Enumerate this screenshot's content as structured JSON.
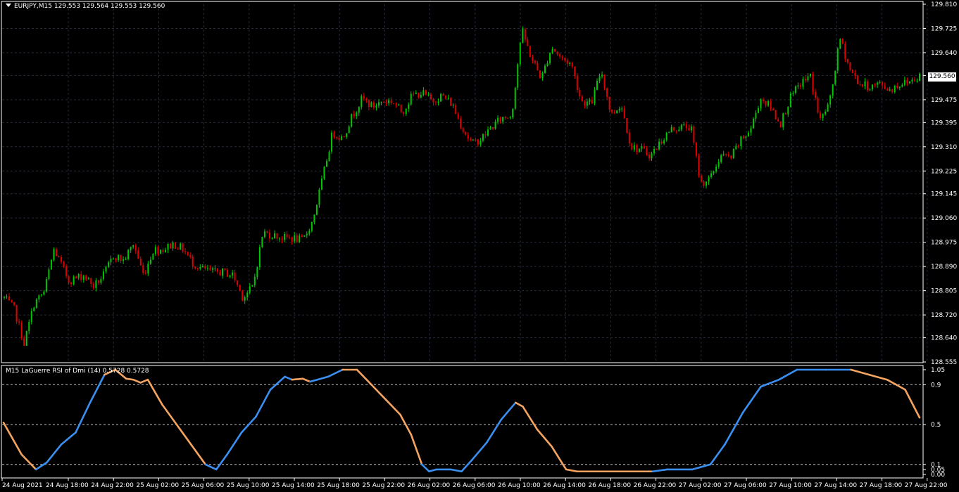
{
  "main_title": "EURJPY,M15  129.553 129.564 129.553 129.560",
  "indicator_title": "M15 LaGuerre RSI of Dmi (14) 0.5728 0.5728",
  "current_price": "129.560",
  "colors": {
    "background": "#000000",
    "grid": "#232b3d",
    "bull_candle": "#00c800",
    "bear_candle": "#e00000",
    "rsi_up": "#3b8ff0",
    "rsi_down": "#f4a460",
    "level_line": "#bfbfbf"
  },
  "chart_data": [
    {
      "type": "candlestick",
      "symbol": "EURJPY",
      "timeframe": "M15",
      "ylim": [
        128.555,
        129.81
      ],
      "y_ticks": [
        "129.810",
        "129.725",
        "129.640",
        "129.560",
        "129.475",
        "129.395",
        "129.310",
        "129.225",
        "129.145",
        "129.060",
        "128.975",
        "128.890",
        "128.805",
        "128.720",
        "128.640",
        "128.555"
      ],
      "x_ticks": [
        "24 Aug 2021",
        "24 Aug 18:00",
        "24 Aug 22:00",
        "25 Aug 02:00",
        "25 Aug 06:00",
        "25 Aug 10:00",
        "25 Aug 14:00",
        "25 Aug 18:00",
        "25 Aug 22:00",
        "26 Aug 02:00",
        "26 Aug 06:00",
        "26 Aug 10:00",
        "26 Aug 14:00",
        "26 Aug 18:00",
        "26 Aug 22:00",
        "27 Aug 02:00",
        "27 Aug 06:00",
        "27 Aug 10:00",
        "27 Aug 14:00",
        "27 Aug 18:00",
        "27 Aug 22:00"
      ],
      "close_path": [
        [
          0,
          128.78
        ],
        [
          4,
          128.74
        ],
        [
          8,
          128.62
        ],
        [
          12,
          128.76
        ],
        [
          16,
          128.8
        ],
        [
          20,
          128.95
        ],
        [
          26,
          128.84
        ],
        [
          32,
          128.86
        ],
        [
          36,
          128.82
        ],
        [
          40,
          128.86
        ],
        [
          44,
          128.93
        ],
        [
          48,
          128.91
        ],
        [
          52,
          128.97
        ],
        [
          56,
          128.86
        ],
        [
          60,
          128.95
        ],
        [
          64,
          128.95
        ],
        [
          68,
          128.97
        ],
        [
          72,
          128.95
        ],
        [
          76,
          128.9
        ],
        [
          80,
          128.88
        ],
        [
          84,
          128.87
        ],
        [
          88,
          128.87
        ],
        [
          92,
          128.86
        ],
        [
          96,
          128.78
        ],
        [
          100,
          128.82
        ],
        [
          104,
          129.01
        ],
        [
          108,
          129.0
        ],
        [
          112,
          128.99
        ],
        [
          116,
          128.99
        ],
        [
          120,
          128.98
        ],
        [
          124,
          129.05
        ],
        [
          128,
          129.2
        ],
        [
          132,
          129.36
        ],
        [
          136,
          129.34
        ],
        [
          140,
          129.42
        ],
        [
          144,
          129.48
        ],
        [
          148,
          129.45
        ],
        [
          152,
          129.47
        ],
        [
          156,
          129.47
        ],
        [
          160,
          129.43
        ],
        [
          164,
          129.49
        ],
        [
          168,
          129.5
        ],
        [
          172,
          129.47
        ],
        [
          176,
          129.49
        ],
        [
          180,
          129.46
        ],
        [
          184,
          129.38
        ],
        [
          188,
          129.32
        ],
        [
          192,
          129.34
        ],
        [
          196,
          129.38
        ],
        [
          200,
          129.41
        ],
        [
          204,
          129.42
        ],
        [
          208,
          129.72
        ],
        [
          212,
          129.62
        ],
        [
          216,
          129.55
        ],
        [
          220,
          129.66
        ],
        [
          224,
          129.62
        ],
        [
          228,
          129.6
        ],
        [
          232,
          129.47
        ],
        [
          236,
          129.46
        ],
        [
          240,
          129.58
        ],
        [
          244,
          129.42
        ],
        [
          248,
          129.46
        ],
        [
          252,
          129.31
        ],
        [
          256,
          129.3
        ],
        [
          260,
          129.28
        ],
        [
          264,
          129.33
        ],
        [
          268,
          129.37
        ],
        [
          272,
          129.38
        ],
        [
          276,
          129.38
        ],
        [
          280,
          129.18
        ],
        [
          284,
          129.2
        ],
        [
          288,
          129.28
        ],
        [
          292,
          129.27
        ],
        [
          296,
          129.33
        ],
        [
          300,
          129.37
        ],
        [
          304,
          129.48
        ],
        [
          308,
          129.45
        ],
        [
          312,
          129.39
        ],
        [
          316,
          129.48
        ],
        [
          320,
          129.53
        ],
        [
          324,
          129.56
        ],
        [
          328,
          129.4
        ],
        [
          332,
          129.47
        ],
        [
          336,
          129.69
        ],
        [
          340,
          129.58
        ],
        [
          344,
          129.53
        ],
        [
          348,
          129.52
        ],
        [
          352,
          129.53
        ],
        [
          356,
          129.51
        ],
        [
          360,
          129.53
        ],
        [
          364,
          129.54
        ],
        [
          368,
          129.56
        ]
      ]
    },
    {
      "type": "line",
      "ylim": [
        0.0,
        1.05
      ],
      "y_ticks": [
        "1.05",
        "0.9",
        "0.5",
        "0.1",
        "0.05",
        "0.00"
      ],
      "levels": [
        0.9,
        0.5,
        0.1
      ],
      "points": [
        [
          0,
          0.52,
          "d"
        ],
        [
          10,
          0.2,
          "d"
        ],
        [
          18,
          0.05,
          "d"
        ],
        [
          24,
          0.12,
          "u"
        ],
        [
          32,
          0.3,
          "u"
        ],
        [
          40,
          0.42,
          "u"
        ],
        [
          48,
          0.72,
          "u"
        ],
        [
          56,
          1.0,
          "u"
        ],
        [
          62,
          1.05,
          "d"
        ],
        [
          68,
          0.96,
          "d"
        ],
        [
          72,
          0.95,
          "d"
        ],
        [
          76,
          0.92,
          "d"
        ],
        [
          80,
          0.95,
          "d"
        ],
        [
          88,
          0.7,
          "d"
        ],
        [
          96,
          0.5,
          "d"
        ],
        [
          104,
          0.3,
          "d"
        ],
        [
          112,
          0.1,
          "d"
        ],
        [
          118,
          0.05,
          "u"
        ],
        [
          124,
          0.2,
          "u"
        ],
        [
          132,
          0.42,
          "u"
        ],
        [
          140,
          0.58,
          "u"
        ],
        [
          148,
          0.85,
          "u"
        ],
        [
          156,
          0.98,
          "u"
        ],
        [
          160,
          0.95,
          "u"
        ],
        [
          166,
          0.96,
          "d"
        ],
        [
          170,
          0.93,
          "d"
        ],
        [
          174,
          0.95,
          "u"
        ],
        [
          180,
          0.98,
          "u"
        ],
        [
          188,
          1.05,
          "u"
        ],
        [
          196,
          1.05,
          "d"
        ],
        [
          204,
          0.9,
          "d"
        ],
        [
          212,
          0.75,
          "d"
        ],
        [
          220,
          0.6,
          "d"
        ],
        [
          226,
          0.4,
          "d"
        ],
        [
          232,
          0.1,
          "d"
        ],
        [
          236,
          0.03,
          "u"
        ],
        [
          240,
          0.05,
          "u"
        ],
        [
          248,
          0.05,
          "u"
        ],
        [
          254,
          0.03,
          "u"
        ],
        [
          260,
          0.15,
          "u"
        ],
        [
          268,
          0.32,
          "u"
        ],
        [
          276,
          0.55,
          "u"
        ],
        [
          284,
          0.72,
          "u"
        ],
        [
          288,
          0.68,
          "d"
        ],
        [
          296,
          0.45,
          "d"
        ],
        [
          304,
          0.28,
          "d"
        ],
        [
          312,
          0.05,
          "d"
        ],
        [
          318,
          0.03,
          "d"
        ],
        [
          340,
          0.03,
          "d"
        ],
        [
          360,
          0.03,
          "d"
        ],
        [
          368,
          0.05,
          "u"
        ],
        [
          382,
          0.05,
          "u"
        ],
        [
          392,
          0.1,
          "u"
        ],
        [
          400,
          0.3,
          "u"
        ],
        [
          410,
          0.62,
          "u"
        ],
        [
          420,
          0.88,
          "u"
        ],
        [
          430,
          0.95,
          "u"
        ],
        [
          440,
          1.05,
          "u"
        ],
        [
          456,
          1.05,
          "u"
        ],
        [
          470,
          1.05,
          "u"
        ],
        [
          480,
          1.0,
          "d"
        ],
        [
          490,
          0.95,
          "d"
        ],
        [
          500,
          0.85,
          "d"
        ],
        [
          508,
          0.57,
          "d"
        ]
      ]
    }
  ]
}
